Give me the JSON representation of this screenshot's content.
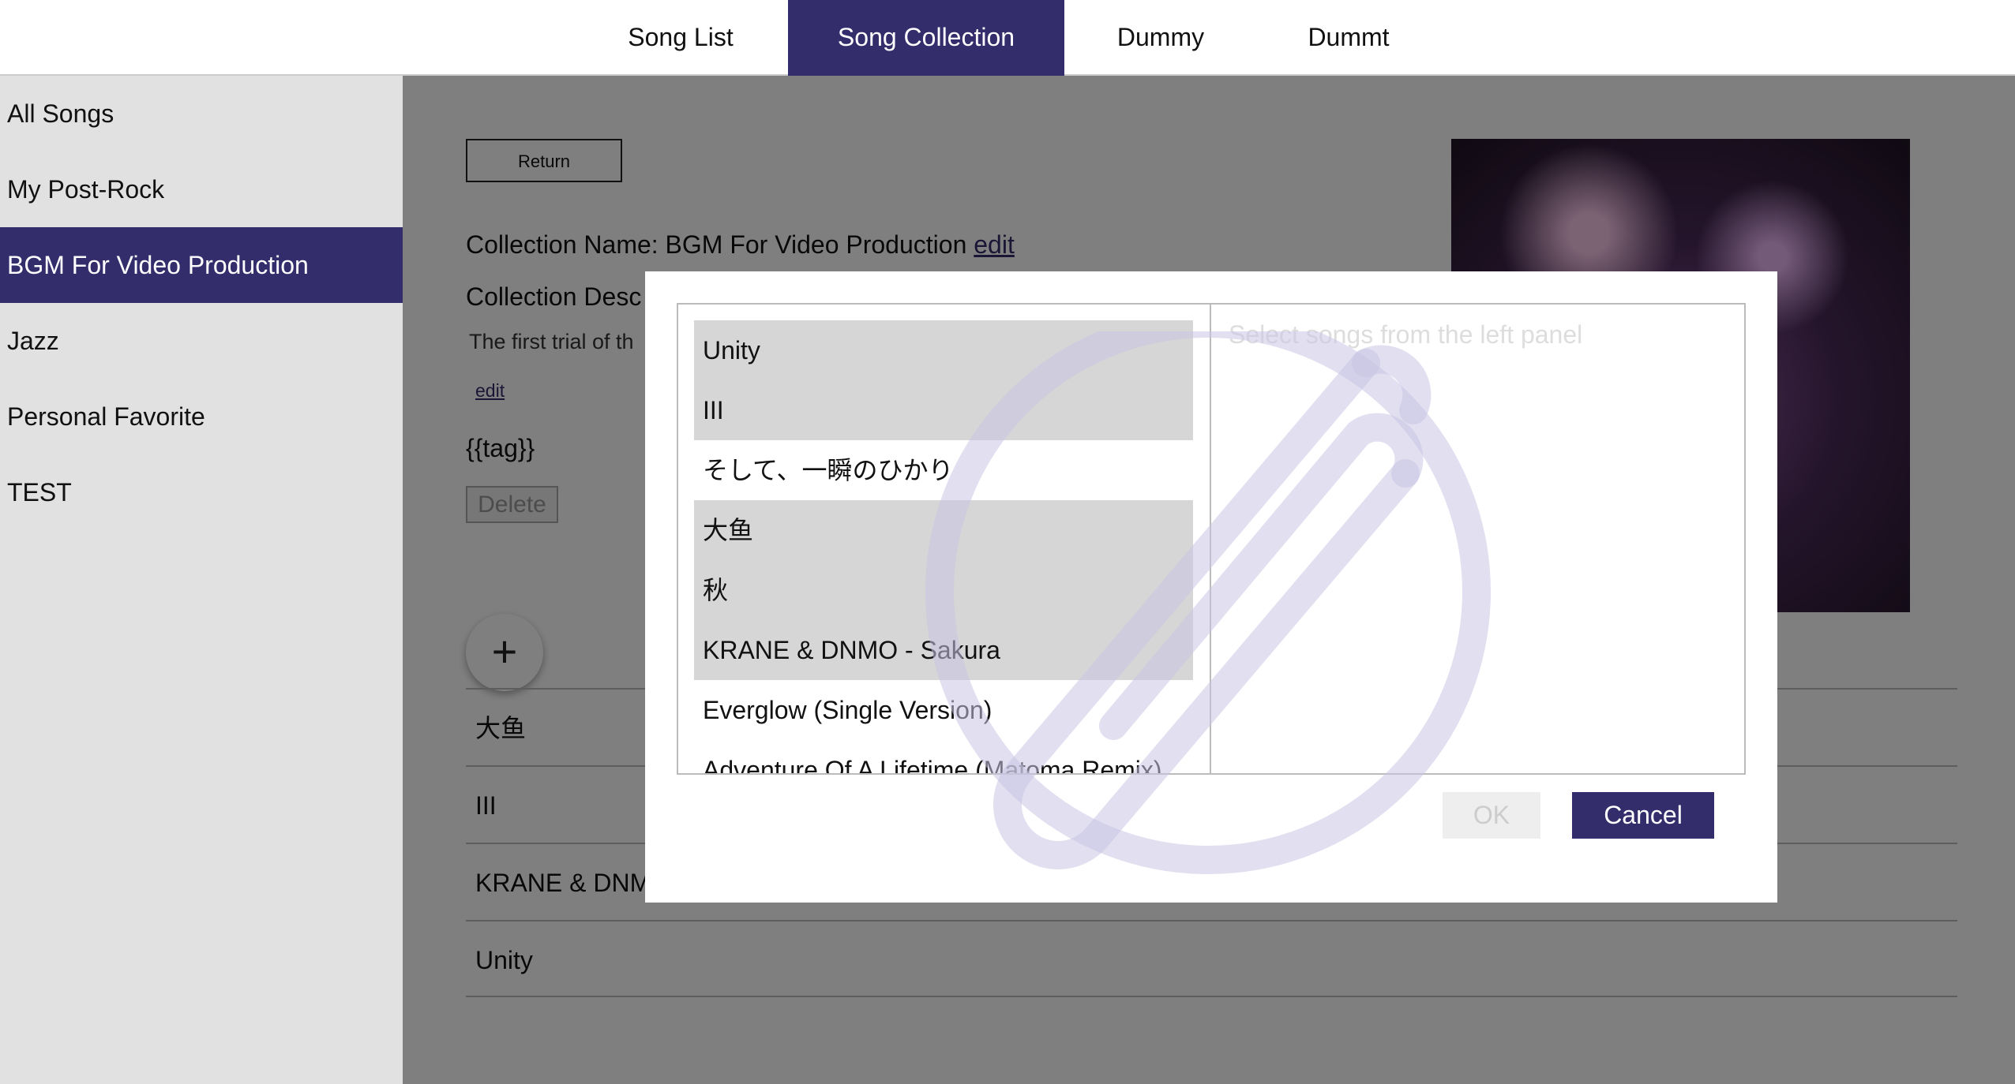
{
  "nav": {
    "tabs": [
      "Song List",
      "Song Collection",
      "Dummy",
      "Dummt"
    ],
    "active_tab": "Song Collection"
  },
  "sidebar": {
    "items": [
      "All Songs",
      "My Post-Rock",
      "BGM For Video Production",
      "Jazz",
      "Personal Favorite",
      "TEST"
    ],
    "active_item": "BGM For Video Production"
  },
  "main": {
    "return_label": "Return",
    "collection_name_label": "Collection Name: BGM For Video Production",
    "edit_label": "edit",
    "collection_desc_label": "Collection Desc",
    "description_text": "The first trial of th",
    "desc_edit_label": "edit",
    "tag_text": "{{tag}}",
    "delete_label": "Delete",
    "add_symbol": "+",
    "songs": [
      "大鱼",
      "III",
      "KRANE & DNMO - Sakura",
      "Unity"
    ]
  },
  "dialog": {
    "placeholder": "Select songs from the left panel",
    "list": [
      {
        "title": "Unity",
        "selected": true
      },
      {
        "title": "III",
        "selected": true
      },
      {
        "title": "そして、一瞬のひかり",
        "selected": false
      },
      {
        "title": "大鱼",
        "selected": true
      },
      {
        "title": "秋",
        "selected": true
      },
      {
        "title": "KRANE & DNMO - Sakura",
        "selected": true
      },
      {
        "title": "Everglow (Single Version)",
        "selected": false
      },
      {
        "title": "Adventure Of A Lifetime (Matoma Remix)",
        "selected": false
      }
    ],
    "ok_label": "OK",
    "cancel_label": "Cancel"
  },
  "colors": {
    "accent": "#342d6b",
    "sidebar_bg": "#e1e1e1",
    "selected_row": "#d6d6d6"
  }
}
